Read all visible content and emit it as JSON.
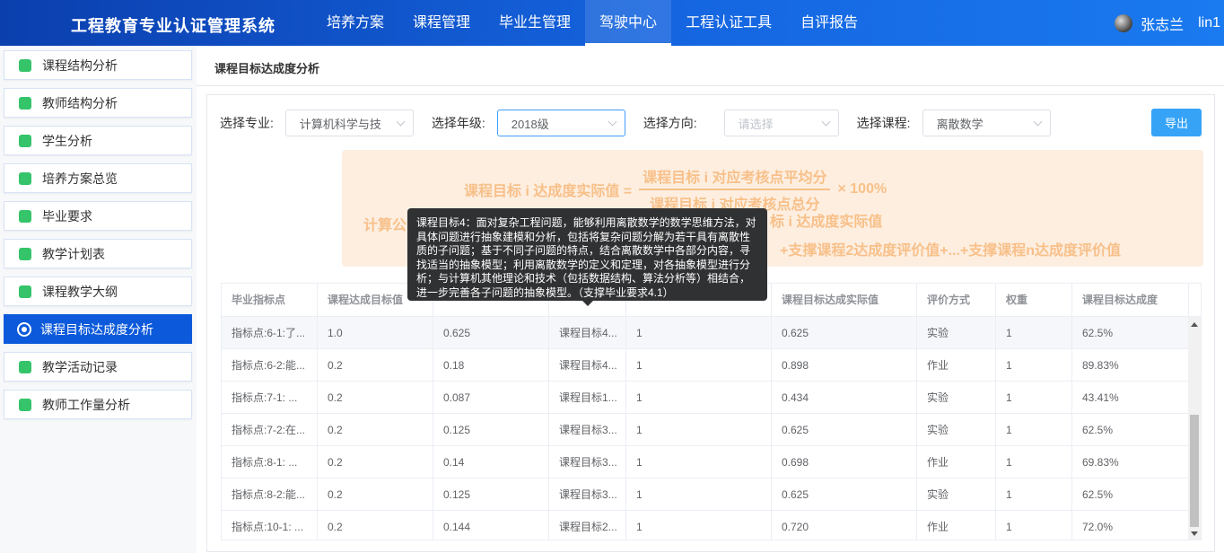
{
  "header": {
    "title": "工程教育专业认证管理系统",
    "nav": [
      "培养方案",
      "课程管理",
      "毕业生管理",
      "驾驶中心",
      "工程认证工具",
      "自评报告"
    ],
    "active_nav": "驾驶中心",
    "user_name": "张志兰",
    "user_id": "lin1"
  },
  "sidebar": {
    "items": [
      {
        "label": "课程结构分析",
        "icon": "chat-icon"
      },
      {
        "label": "教师结构分析",
        "icon": "person-icon"
      },
      {
        "label": "学生分析",
        "icon": "student-icon"
      },
      {
        "label": "培养方案总览",
        "icon": "grid-icon"
      },
      {
        "label": "毕业要求",
        "icon": "list-icon"
      },
      {
        "label": "教学计划表",
        "icon": "doc-icon"
      },
      {
        "label": "课程教学大纲",
        "icon": "outline-icon"
      },
      {
        "label": "课程目标达成度分析",
        "icon": "target-icon"
      },
      {
        "label": "教学活动记录",
        "icon": "ball-icon"
      },
      {
        "label": "教师工作量分析",
        "icon": "briefcase-icon"
      }
    ],
    "active_index": 7
  },
  "page": {
    "breadcrumb": "课程目标达成度分析"
  },
  "filters": {
    "major_label": "选择专业:",
    "major_value": "计算机科学与技",
    "grade_label": "选择年级:",
    "grade_value": "2018级",
    "direction_label": "选择方向:",
    "direction_placeholder": "请选择",
    "course_label": "选择课程:",
    "course_value": "离散数学",
    "export_label": "导出"
  },
  "formula": {
    "lhs": "课程目标 i 达成度实际值 =",
    "numerator": "课程目标 i 对应考核点平均分",
    "denominator": "课程目标 i 对应考核点总分",
    "multiplier": "× 100%",
    "line2_left": "计算公",
    "line2_right": "标 i 达成度实际值",
    "line3": "+支撑课程2达成度评价值+...+支撑课程n达成度评价值"
  },
  "table": {
    "headers": [
      "毕业指标点",
      "课程达成目标值",
      "",
      "",
      "",
      "课程目标达成实际值",
      "评价方式",
      "权重",
      "课程目标达成度"
    ],
    "rows": [
      [
        "指标点:6-1:了...",
        "1.0",
        "0.625",
        "课程目标4...",
        "1",
        "0.625",
        "实验",
        "1",
        "62.5%"
      ],
      [
        "指标点:6-2:能...",
        "0.2",
        "0.18",
        "课程目标4...",
        "1",
        "0.898",
        "作业",
        "1",
        "89.83%"
      ],
      [
        "指标点:7-1: ...",
        "0.2",
        "0.087",
        "课程目标1...",
        "1",
        "0.434",
        "实验",
        "1",
        "43.41%"
      ],
      [
        "指标点:7-2:在...",
        "0.2",
        "0.125",
        "课程目标3...",
        "1",
        "0.625",
        "实验",
        "1",
        "62.5%"
      ],
      [
        "指标点:8-1: ...",
        "0.2",
        "0.14",
        "课程目标3...",
        "1",
        "0.698",
        "作业",
        "1",
        "69.83%"
      ],
      [
        "指标点:8-2:能...",
        "0.2",
        "0.125",
        "课程目标3...",
        "1",
        "0.625",
        "实验",
        "1",
        "62.5%"
      ],
      [
        "指标点:10-1: ...",
        "0.2",
        "0.144",
        "课程目标2...",
        "1",
        "0.720",
        "作业",
        "1",
        "72.0%"
      ]
    ]
  },
  "tooltip": {
    "text": "课程目标4：面对复杂工程问题，能够利用离散数学的数学思维方法，对具体问题进行抽象建模和分析，包括将复杂问题分解为若干具有离散性质的子问题；基于不同子问题的特点，结合离散数学中各部分内容，寻找适当的抽象模型；利用离散数学的定义和定理，对各抽象模型进行分析；与计算机其他理论和技术（包括数据结构、算法分析等）相结合，进一步完善各子问题的抽象模型。（支撑毕业要求4.1）"
  },
  "colors": {
    "header_start": "#0b3fae",
    "header_end": "#1a7af0",
    "sidebar_active": "#0c5adb",
    "export_button": "#36a3f7",
    "formula_bg": "#fdeee0",
    "formula_text": "#f8c089",
    "icon_green": "#35c46a"
  }
}
